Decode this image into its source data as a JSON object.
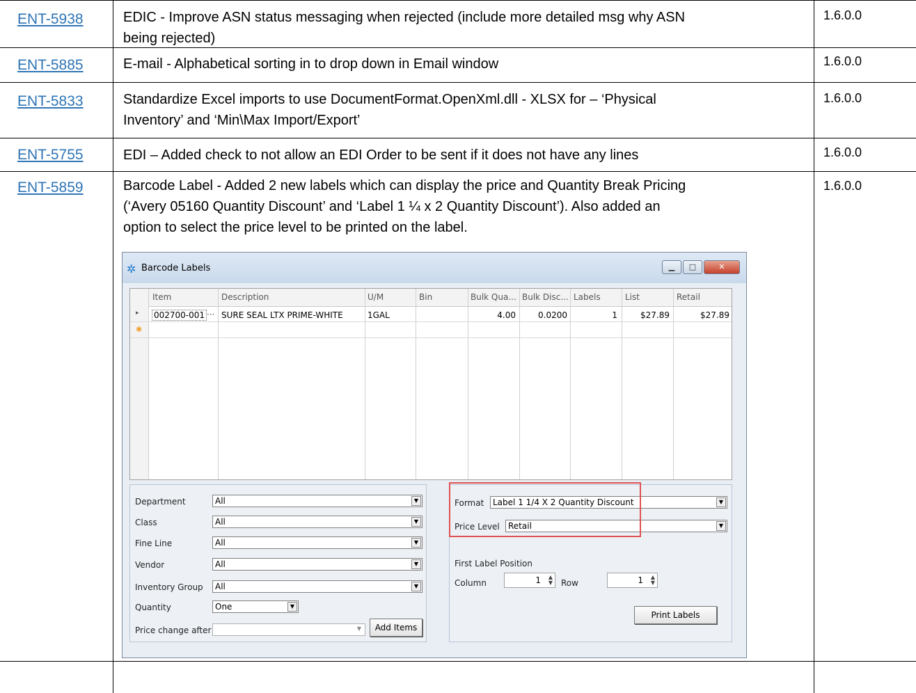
{
  "rows": [
    {
      "ticket": "ENT-5938",
      "lines": [
        "EDIC - Improve ASN status messaging when rejected (include more detailed msg why ASN",
        "being rejected)"
      ],
      "version": "1.6.0.0"
    },
    {
      "ticket": "ENT-5885",
      "lines": [
        "E-mail - Alphabetical sorting in to drop down in Email window"
      ],
      "version": "1.6.0.0"
    },
    {
      "ticket": "ENT-5833",
      "lines": [
        "Standardize Excel imports to use DocumentFormat.OpenXml.dll - XLSX for – ‘Physical",
        "Inventory’ and ‘Min\\Max Import/Export’"
      ],
      "version": "1.6.0.0"
    },
    {
      "ticket": "ENT-5755",
      "lines": [
        "EDI – Added check to not allow an EDI Order to be sent if it does not have any lines"
      ],
      "version": "1.6.0.0"
    },
    {
      "ticket": "ENT-5859",
      "lines": [
        "Barcode Label - Added 2 new labels which can display the price and Quantity Break Pricing",
        "(‘Avery 05160 Quantity Discount’ and ‘Label 1 ¼ x 2 Quantity Discount’).  Also added an",
        "option to select the price level to be printed on the label."
      ],
      "version": "1.6.0.0"
    }
  ],
  "window": {
    "title": "Barcode Labels",
    "minimize_glyph": "▁",
    "maximize_glyph": "□",
    "close_glyph": "✕",
    "grid": {
      "headers": [
        "Item",
        "Description",
        "U/M",
        "Bin",
        "Bulk Qua...",
        "Bulk Disc...",
        "Labels",
        "List",
        "Retail"
      ],
      "row": {
        "indicator": "▸",
        "item": "002700-001",
        "ellipsis": "···",
        "description": "SURE SEAL LTX PRIME-WHITE",
        "um": "1GAL",
        "bin": "",
        "bulk_qty": "4.00",
        "bulk_disc": "0.0200",
        "labels": "1",
        "list": "$27.89",
        "retail": "$27.89"
      },
      "new_row_marker": "✱"
    },
    "filters": {
      "department": {
        "label": "Department",
        "value": "All"
      },
      "class": {
        "label": "Class",
        "value": "All"
      },
      "fine_line": {
        "label": "Fine Line",
        "value": "All"
      },
      "vendor": {
        "label": "Vendor",
        "value": "All"
      },
      "inventory_group": {
        "label": "Inventory Group",
        "value": "All"
      },
      "quantity": {
        "label": "Quantity",
        "value": "One"
      },
      "price_change_after": {
        "label": "Price change after",
        "value": ""
      },
      "add_items": "Add Items"
    },
    "format": {
      "label": "Format",
      "value": "Label 1 1/4 X 2 Quantity Discount"
    },
    "price_level": {
      "label": "Price Level",
      "value": "Retail"
    },
    "first_label_position": "First Label Position",
    "column": {
      "label": "Column",
      "value": "1"
    },
    "row_pos": {
      "label": "Row",
      "value": "1"
    },
    "print_labels": "Print Labels",
    "dropdown_glyph": "▼",
    "spin_up": "▲",
    "spin_down": "▼"
  }
}
